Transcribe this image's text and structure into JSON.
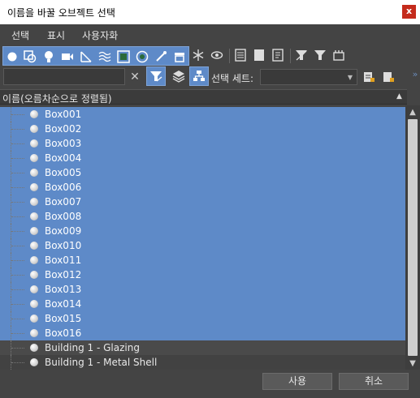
{
  "window": {
    "title": "이름을 바꿀 오브젝트 선택",
    "close_glyph": "x"
  },
  "menu": [
    "선택",
    "표시",
    "사용자화"
  ],
  "toolbar": {
    "type_filters": [
      "geometry-icon",
      "shapes-icon",
      "lights-icon",
      "cameras-icon",
      "helpers-icon",
      "spacewarps-icon",
      "groups-icon",
      "xrefs-icon",
      "bones-icon",
      "containers-icon"
    ],
    "frozen_icon": "snowflake-icon",
    "hidden_icon": "eye-icon",
    "extras": [
      "display-all-icon",
      "display-none-icon",
      "invert-display-icon",
      "filter-options-icon",
      "filter-icon",
      "select-dependents-icon"
    ]
  },
  "search": {
    "value": "",
    "clear_glyph": "✕"
  },
  "selection_set": {
    "label": "선택 세트:",
    "value": ""
  },
  "column": {
    "header": "이름(오름차순으로 정렬됨)",
    "sort_glyph": "▲"
  },
  "list": {
    "items": [
      {
        "name": "Box001",
        "selected": true
      },
      {
        "name": "Box002",
        "selected": true
      },
      {
        "name": "Box003",
        "selected": true
      },
      {
        "name": "Box004",
        "selected": true
      },
      {
        "name": "Box005",
        "selected": true
      },
      {
        "name": "Box006",
        "selected": true
      },
      {
        "name": "Box007",
        "selected": true
      },
      {
        "name": "Box008",
        "selected": true
      },
      {
        "name": "Box009",
        "selected": true
      },
      {
        "name": "Box010",
        "selected": true
      },
      {
        "name": "Box011",
        "selected": true
      },
      {
        "name": "Box012",
        "selected": true
      },
      {
        "name": "Box013",
        "selected": true
      },
      {
        "name": "Box014",
        "selected": true
      },
      {
        "name": "Box015",
        "selected": true
      },
      {
        "name": "Box016",
        "selected": true
      },
      {
        "name": "Building 1 - Glazing",
        "selected": false
      },
      {
        "name": "Building 1 - Metal Shell",
        "selected": false
      }
    ]
  },
  "buttons": {
    "apply": "사용",
    "cancel": "취소"
  },
  "colors": {
    "selection": "#5e8ac8",
    "background": "#444444",
    "close": "#c42b1c"
  }
}
